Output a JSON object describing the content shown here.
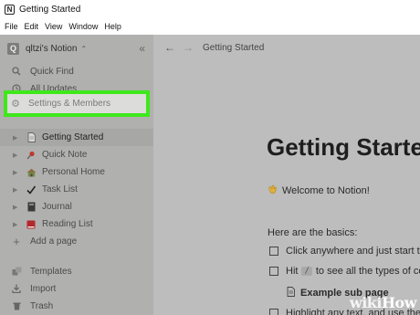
{
  "window": {
    "title": "Getting Started"
  },
  "menu": [
    "File",
    "Edit",
    "View",
    "Window",
    "Help"
  ],
  "sidebar": {
    "workspace_badge": "Q",
    "workspace_name": "qltzi's Notion",
    "nav": [
      {
        "label": "Quick Find",
        "icon": "search-icon"
      },
      {
        "label": "All Updates",
        "icon": "clock-icon"
      },
      {
        "label": "Settings & Members",
        "icon": "gear-icon"
      }
    ],
    "pages": [
      {
        "label": "Getting Started",
        "icon": "page-icon"
      },
      {
        "label": "Quick Note",
        "icon": "pushpin-icon"
      },
      {
        "label": "Personal Home",
        "icon": "house-icon"
      },
      {
        "label": "Task List",
        "icon": "check-mark-icon"
      },
      {
        "label": "Journal",
        "icon": "notebook-icon"
      },
      {
        "label": "Reading List",
        "icon": "book-icon"
      }
    ],
    "add_page": "Add a page",
    "bottom": [
      {
        "label": "Templates",
        "icon": "templates-icon"
      },
      {
        "label": "Import",
        "icon": "import-icon"
      },
      {
        "label": "Trash",
        "icon": "trash-icon"
      }
    ]
  },
  "main": {
    "breadcrumb": "Getting Started",
    "title": "Getting Started",
    "welcome": "Welcome to Notion!",
    "basics_heading": "Here are the basics:",
    "todos": [
      {
        "text": "Click anywhere and just start typing"
      },
      {
        "pre": "Hit",
        "key": "/",
        "post": "to see all the types of content you can add"
      },
      {
        "text": "Highlight any text, and use the menu"
      }
    ],
    "sub_page": "Example sub page"
  },
  "watermark": {
    "wiki": "wiki",
    "how": "How"
  },
  "colors": {
    "highlight": "#3ee81b",
    "sidebar": "#b0b0ae",
    "main": "#bdbdbd"
  }
}
